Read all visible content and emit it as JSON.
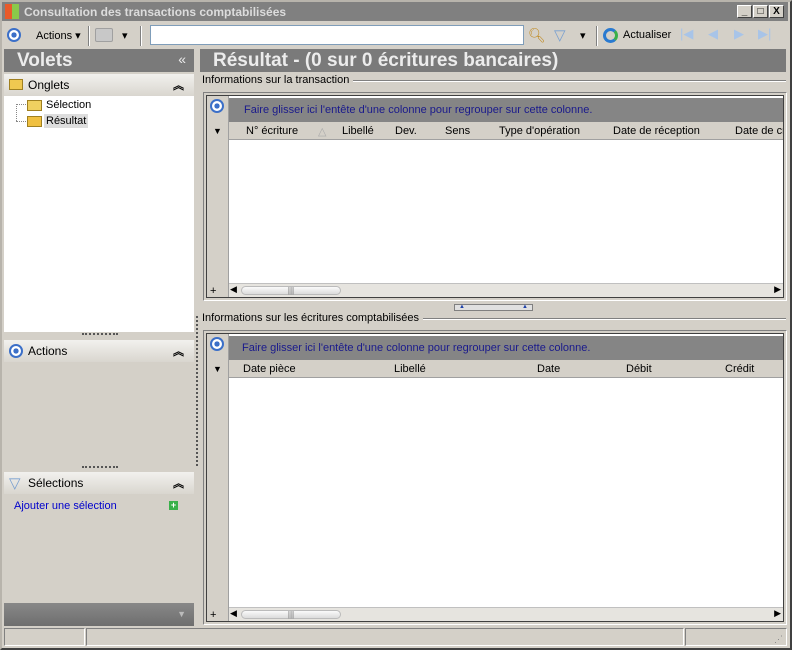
{
  "window": {
    "title": "Consultation des transactions comptabilisées",
    "buttons": [
      "_",
      "□",
      "X"
    ]
  },
  "toolbar": {
    "actions_label": "Actions",
    "search_value": "",
    "refresh_label": "Actualiser",
    "icons": [
      "radio-icon",
      "printer-icon",
      "search-icon",
      "filter-icon",
      "refresh-icon",
      "first-icon",
      "prev-icon",
      "next-icon",
      "last-icon"
    ]
  },
  "sidebar": {
    "title": "Volets",
    "collapse": "«",
    "tabs_section": {
      "title": "Onglets",
      "items": [
        {
          "label": "Sélection"
        },
        {
          "label": "Résultat",
          "selected": true
        }
      ]
    },
    "actions_section": {
      "title": "Actions"
    },
    "selections_section": {
      "title": "Sélections",
      "add_link": "Ajouter une sélection"
    }
  },
  "main": {
    "title": "Résultat - (0 sur 0 écritures bancaires)",
    "transaction": {
      "label": "Informations sur la transaction",
      "group_hint": "Faire glisser ici l'entête d'une colonne pour regrouper sur cette colonne.",
      "columns": [
        "N° écriture",
        "Libellé",
        "Dev.",
        "Sens",
        "Type d'opération",
        "Date de réception",
        "Date de cr"
      ]
    },
    "entries": {
      "label": "Informations sur les écritures comptabilisées",
      "group_hint": "Faire glisser ici l'entête d'une colonne pour regrouper sur cette colonne.",
      "columns": [
        "Date pièce",
        "Libellé",
        "Date",
        "Débit",
        "Crédit"
      ]
    }
  },
  "colors": {
    "header_dark": "#7a7a7a",
    "link": "#0000cc",
    "group_text": "#1a1a8c"
  }
}
